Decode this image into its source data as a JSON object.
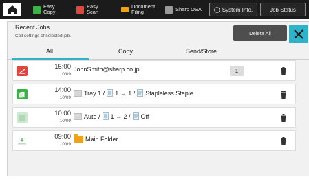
{
  "topbar": {
    "items": [
      {
        "label": "Easy\nCopy",
        "icon": "easy-copy-icon",
        "color": "#3bb14a"
      },
      {
        "label": "Easy\nScan",
        "icon": "easy-scan-icon",
        "color": "#e0463b"
      },
      {
        "label": "Document\nFiling",
        "icon": "document-filing-icon",
        "color": "#f0a11b"
      },
      {
        "label": "Sharp OSA",
        "icon": "sharp-osa-icon",
        "color": "#9a9a9a"
      }
    ],
    "system_info": "System Info.",
    "job_status": "Job Status"
  },
  "recent_jobs": {
    "title": "Recent Jobs",
    "subtitle": "Call settings of selected job.",
    "delete_all": "Delete All"
  },
  "tabs": [
    "All",
    "Copy",
    "Send/Store"
  ],
  "jobs": [
    {
      "time": "15:00",
      "date": "10/09",
      "type_icon": "email-send-icon",
      "type_color": "#e0463b",
      "detail": "JohnSmith@sharp.co.jp",
      "count": "1"
    },
    {
      "time": "14:00",
      "date": "10/09",
      "type_icon": "copy-icon",
      "type_color": "#3bb14a",
      "parts": [
        "Tray 1 /",
        "1 → 1 /",
        "Stapleless Staple"
      ]
    },
    {
      "time": "10:00",
      "date": "10/09",
      "type_icon": "copy-icon",
      "type_color": "#cde8d0",
      "parts": [
        "Auto /",
        "1 → 2 /",
        "Off"
      ]
    },
    {
      "time": "09:00",
      "date": "10/09",
      "type_icon": "folder-store-icon",
      "type_color": "#3bb14a",
      "detail": "Main Folder"
    }
  ]
}
